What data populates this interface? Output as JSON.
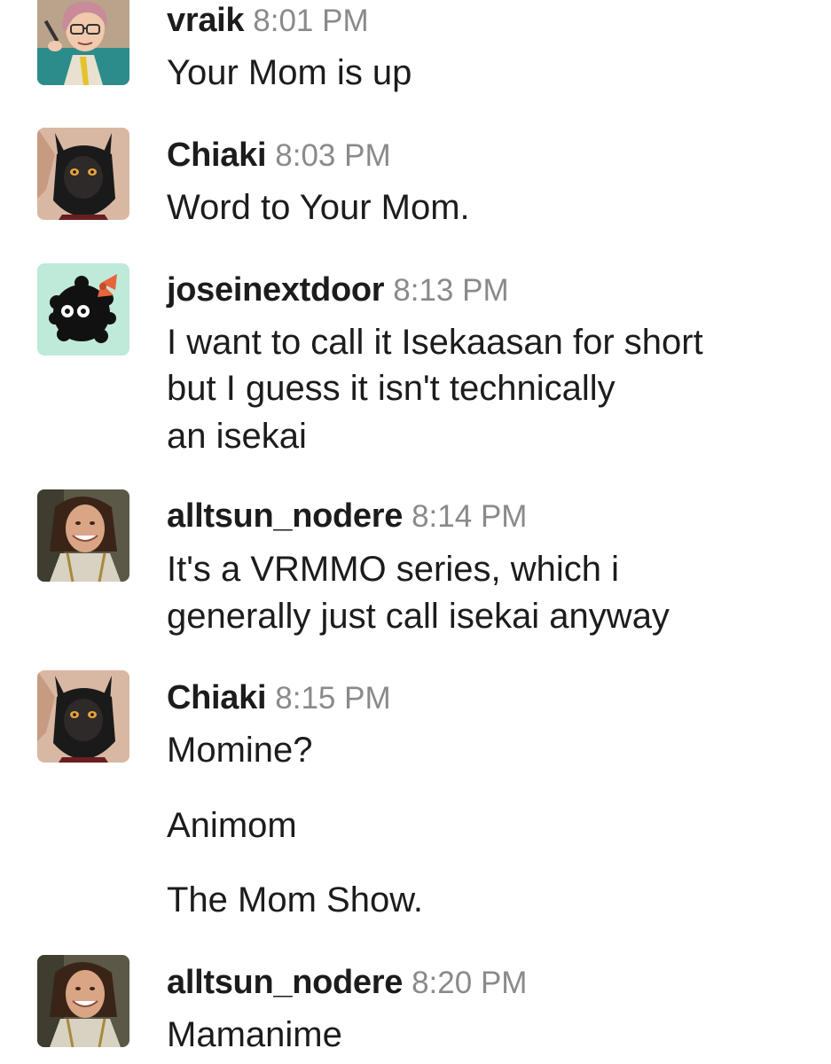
{
  "messages": [
    {
      "user": "vraik",
      "time": "8:01 PM",
      "avatar": "cartoon-woman-glasses-avatar",
      "lines": [
        "Your Mom is up"
      ]
    },
    {
      "user": "Chiaki",
      "time": "8:03 PM",
      "avatar": "dark-catgirl-avatar",
      "lines": [
        "Word to Your Mom."
      ]
    },
    {
      "user": "joseinextdoor",
      "time": "8:13 PM",
      "avatar": "soot-sprite-avatar",
      "lines": [
        "I want to call it Isekaasan for short",
        "but I guess it isn't technically",
        "an isekai"
      ]
    },
    {
      "user": "alltsun_nodere",
      "time": "8:14 PM",
      "avatar": "smiling-woman-photo-avatar",
      "lines": [
        "It's a VRMMO series, which i",
        "generally just call isekai anyway"
      ]
    },
    {
      "user": "Chiaki",
      "time": "8:15 PM",
      "avatar": "dark-catgirl-avatar",
      "lines": [
        "Momine?"
      ],
      "followups": [
        "Animom",
        "The Mom Show."
      ]
    },
    {
      "user": "alltsun_nodere",
      "time": "8:20 PM",
      "avatar": "smiling-woman-photo-avatar",
      "lines": [
        "Mamanime"
      ]
    }
  ],
  "colors": {
    "text": "#1d1c1d",
    "timestamp": "#8a8a8c",
    "soot_bg": "#bfe9d8",
    "bow": "#e8643c"
  }
}
